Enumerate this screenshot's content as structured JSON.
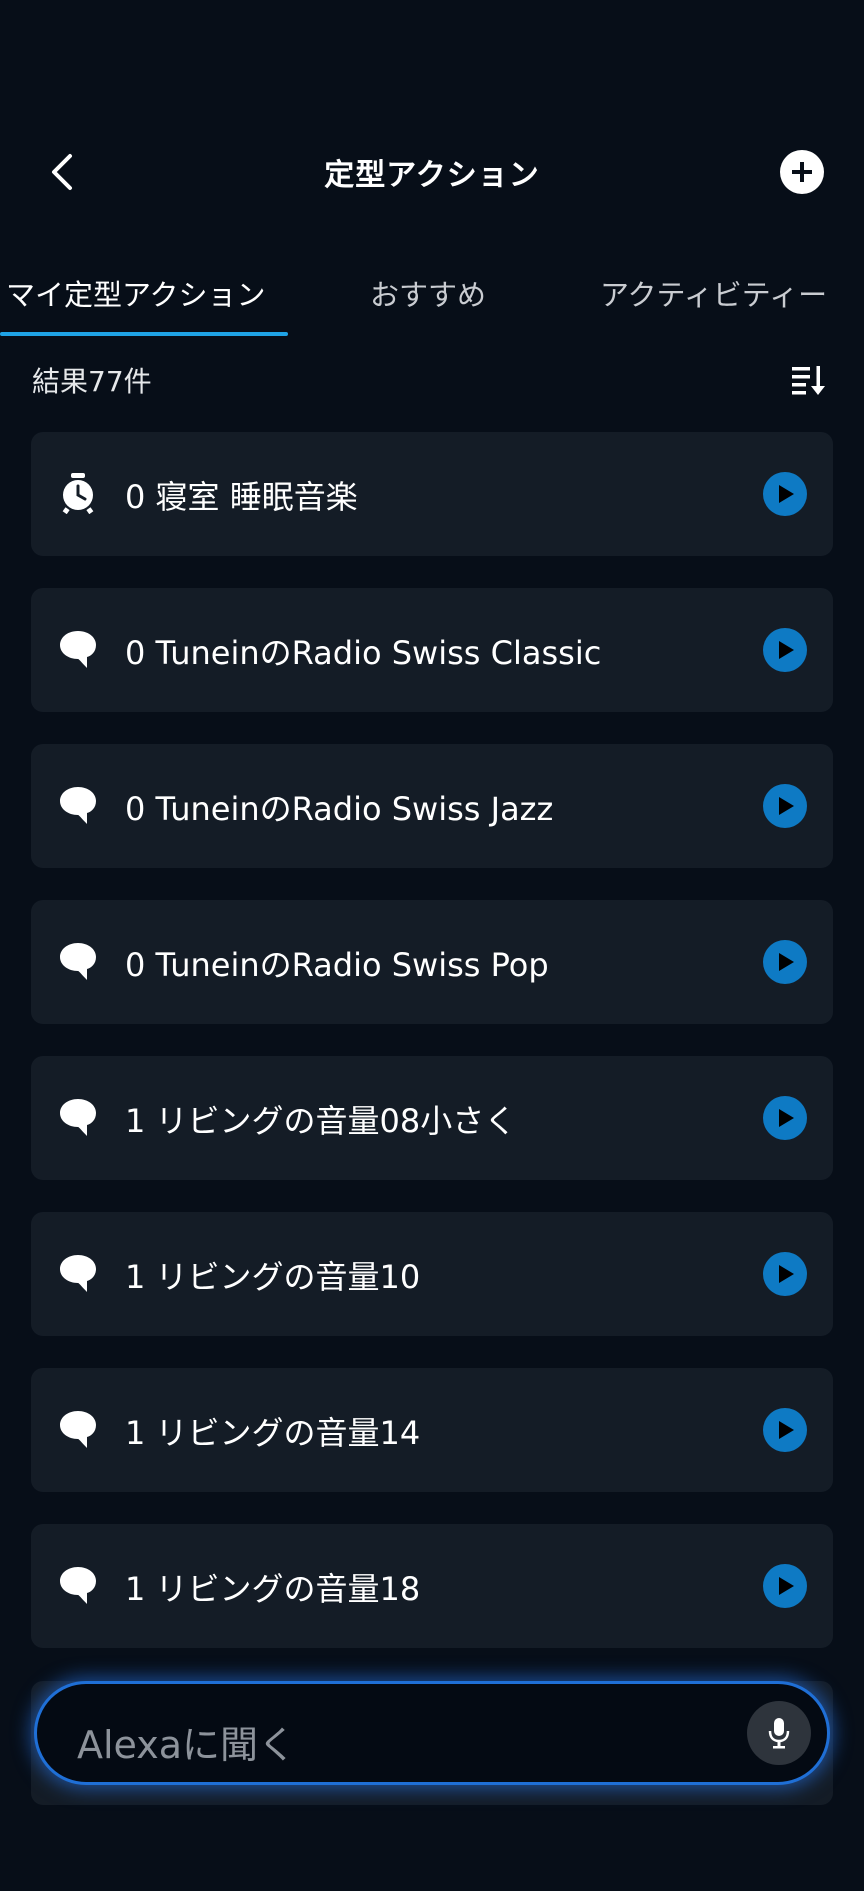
{
  "header": {
    "title": "定型アクション",
    "back_icon": "chevron-left-icon",
    "add_icon": "plus-circle-icon"
  },
  "tabs": [
    {
      "label": "マイ定型アクション",
      "active": true
    },
    {
      "label": "おすすめ",
      "active": false
    },
    {
      "label": "アクティビティー",
      "active": false
    }
  ],
  "results": {
    "count_text": "結果77件",
    "sort_icon": "sort-icon"
  },
  "routines": [
    {
      "icon": "alarm-clock-icon",
      "label": "0 寝室 睡眠音楽"
    },
    {
      "icon": "speech-bubble-icon",
      "label": "0 TuneinのRadio Swiss Classic"
    },
    {
      "icon": "speech-bubble-icon",
      "label": "0 TuneinのRadio Swiss Jazz"
    },
    {
      "icon": "speech-bubble-icon",
      "label": "0 TuneinのRadio Swiss Pop"
    },
    {
      "icon": "speech-bubble-icon",
      "label": "1 リビングの音量08小さく"
    },
    {
      "icon": "speech-bubble-icon",
      "label": "1 リビングの音量10"
    },
    {
      "icon": "speech-bubble-icon",
      "label": "1 リビングの音量14"
    },
    {
      "icon": "speech-bubble-icon",
      "label": "1 リビングの音量18"
    }
  ],
  "ask_bar": {
    "placeholder": "Alexaに聞く",
    "mic_icon": "microphone-icon"
  },
  "colors": {
    "background": "#070e18",
    "card": "#141c26",
    "accent": "#1fa3e6",
    "play": "#0e7ac4"
  }
}
